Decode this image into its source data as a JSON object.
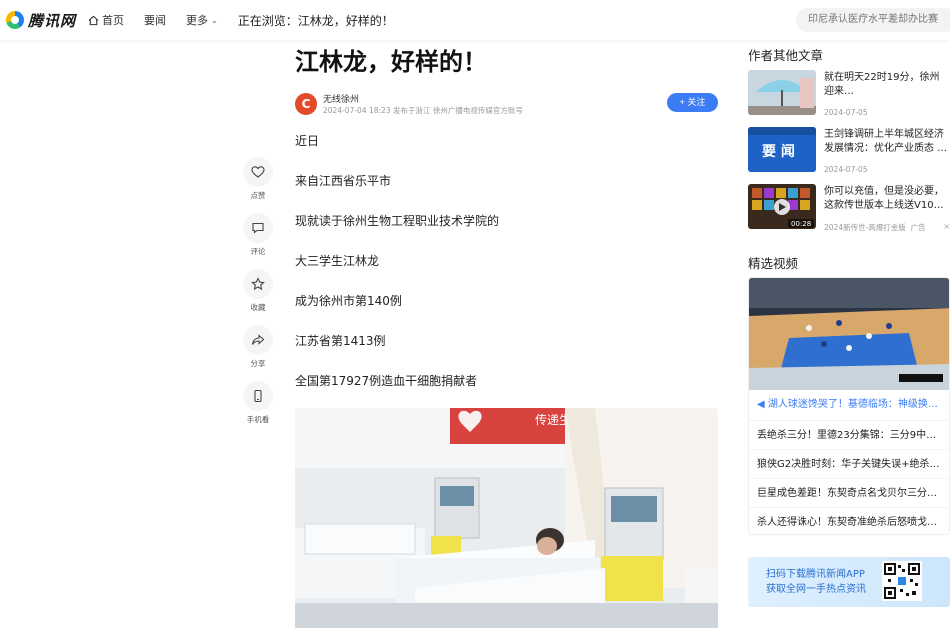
{
  "header": {
    "logo_text": "腾讯网",
    "nav_home": "首页",
    "nav_news": "要闻",
    "nav_more": "更多",
    "browsing": "正在浏览：江林龙，好样的！",
    "search_placeholder": "印尼承认医疗水平差却办比赛"
  },
  "article": {
    "title": "江林龙，好样的！",
    "author_avatar_text": "C",
    "author_name": "无线徐州",
    "author_meta": "2024-07-04 18:23 发布于浙江 徐州广播电视传媒官方账号",
    "follow_label": "+ 关注",
    "paragraphs": [
      "近日",
      "来自江西省乐平市",
      "现就读于徐州生物工程职业技术学院的",
      "大三学生江林龙",
      "成为徐州市第140例",
      "江苏省第1413例",
      "全国第17927例造血干细胞捐献者"
    ],
    "photo_banner_text": "传递生命新希望"
  },
  "actions": [
    {
      "label": "点赞",
      "icon": "heart-icon"
    },
    {
      "label": "评论",
      "icon": "comment-icon"
    },
    {
      "label": "收藏",
      "icon": "star-icon"
    },
    {
      "label": "分享",
      "icon": "share-icon"
    },
    {
      "label": "手机看",
      "icon": "phone-icon"
    }
  ],
  "right": {
    "author_section_title": "作者其他文章",
    "articles": [
      {
        "title": "就在明天22时19分，徐州迎来…",
        "date": "2024-07-05"
      },
      {
        "title": "王剑锋调研上半年城区经济发展情况：优化产业质态 …",
        "date": "2024-07-05",
        "thumb_text": "要 闻"
      },
      {
        "title": "你可以充值，但是没必要，这款传世版本上线送V10…",
        "date": "2024新传世-高爆打金版",
        "ad_label": "广告",
        "close": "×",
        "duration": "00:28"
      }
    ],
    "video_section_title": "精选视频",
    "video_caption": "湖人球迷馋哭了！基德临场：神级换…",
    "video_items": [
      "丢绝杀三分！里德23分集锦：三分9中…",
      "狼侠G2决胜时刻：华子关键失误+绝杀…",
      "巨星成色差距！东契奇点名戈贝尔三分…",
      "杀人还得诛心！东契奇准绝杀后怒喷戈…"
    ],
    "app_banner_line1": "扫码下载腾讯新闻APP",
    "app_banner_line2": "获取全网一手热点资讯"
  }
}
